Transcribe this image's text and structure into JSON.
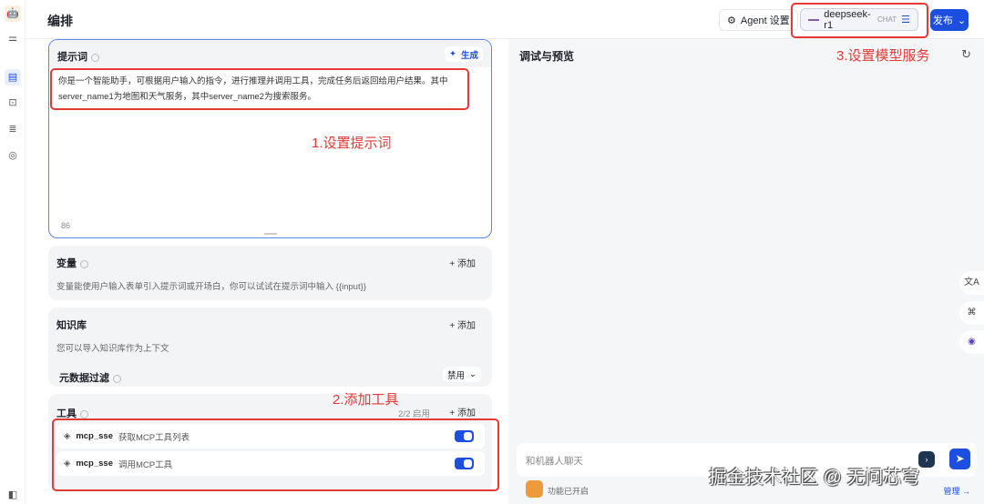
{
  "header": {
    "title": "编排",
    "agent_settings": "Agent 设置",
    "model": "deepseek-r1",
    "model_tag": "CHAT",
    "publish": "发布"
  },
  "prompt": {
    "label": "提示词",
    "generate": "生成",
    "text": "你是一个智能助手，可根据用户输入的指令，进行推理并调用工具，完成任务后返回给用户结果。其中server_name1为地图和天气服务，其中server_name2为搜索服务。",
    "count": "86"
  },
  "variables": {
    "label": "变量",
    "add": "添加",
    "desc": "变量能使用户输入表单引入提示词或开场白，你可以试试在提示词中输入 {{input}}"
  },
  "knowledge": {
    "label": "知识库",
    "add": "添加",
    "desc": "您可以导入知识库作为上下文",
    "filter_label": "元数据过滤",
    "filter_value": "禁用"
  },
  "tools": {
    "label": "工具",
    "count": "2/2 启用",
    "add": "添加",
    "items": [
      {
        "name": "mcp_sse",
        "desc": "获取MCP工具列表",
        "enabled": true
      },
      {
        "name": "mcp_sse",
        "desc": "调用MCP工具",
        "enabled": true
      }
    ]
  },
  "preview": {
    "title": "调试与预览",
    "placeholder": "和机器人聊天",
    "feature": "功能已开启",
    "manage": "管理 →"
  },
  "annotations": {
    "a1": "1.设置提示词",
    "a2": "2.添加工具",
    "a3": "3.设置模型服务"
  },
  "watermark": "掘金技术社区 @ 无问芯穹",
  "colors": {
    "accent": "#1c4fe0",
    "annotation": "#e53935"
  }
}
